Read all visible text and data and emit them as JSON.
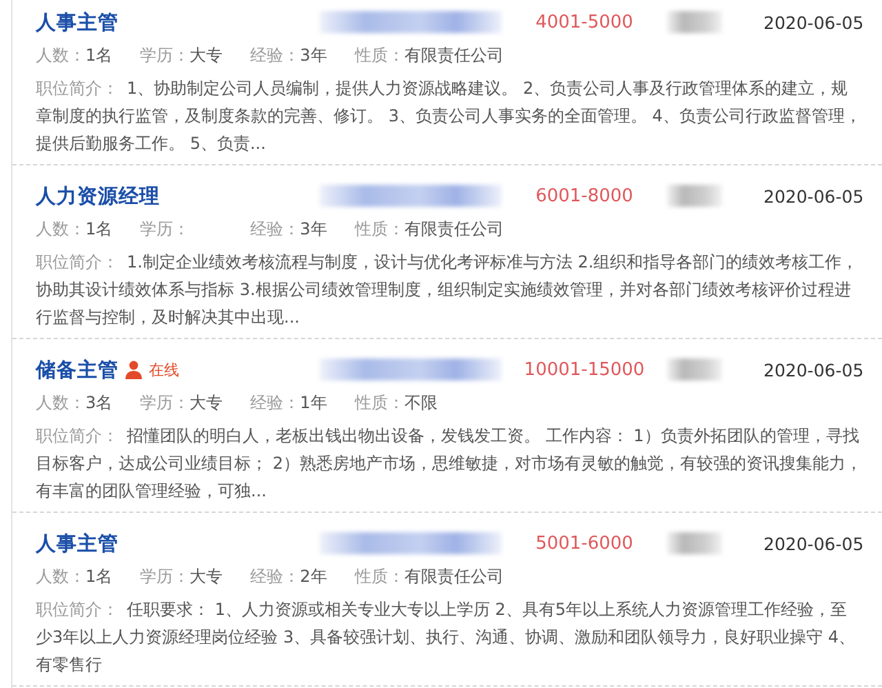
{
  "jobs": [
    {
      "title": "人事主管",
      "online": false,
      "salary": "4001-5000",
      "date": "2020-06-05",
      "meta": [
        {
          "label": "人数：",
          "value": "1名"
        },
        {
          "label": "学历：",
          "value": "大专"
        },
        {
          "label": "经验：",
          "value": "3年"
        },
        {
          "label": "性质：",
          "value": "有限责任公司"
        }
      ],
      "description_label": "职位简介：",
      "description": "1、协助制定公司人员编制，提供人力资源战略建议。 2、负责公司人事及行政管理体系的建立，规章制度的执行监管，及制度条款的完善、修订。 3、负责公司人事实务的全面管理。 4、负责公司行政监督管理，提供后勤服务工作。 5、负责..."
    },
    {
      "title": "人力资源经理",
      "online": false,
      "salary": "6001-8000",
      "date": "2020-06-05",
      "meta": [
        {
          "label": "人数：",
          "value": "1名"
        },
        {
          "label": "学历："
        },
        {
          "label": "经验：",
          "value": "3年"
        },
        {
          "label": "性质：",
          "value": "有限责任公司"
        }
      ],
      "description_label": "职位简介：",
      "description": "1.制定企业绩效考核流程与制度，设计与优化考评标准与方法 2.组织和指导各部门的绩效考核工作，协助其设计绩效体系与指标 3.根据公司绩效管理制度，组织制定实施绩效管理，并对各部门绩效考核评价过程进行监督与控制，及时解决其中出现..."
    },
    {
      "title": "储备主管",
      "online": true,
      "online_label": "在线",
      "salary": "10001-15000",
      "date": "2020-06-05",
      "meta": [
        {
          "label": "人数：",
          "value": "3名"
        },
        {
          "label": "学历：",
          "value": "大专"
        },
        {
          "label": "经验：",
          "value": "1年"
        },
        {
          "label": "性质：",
          "value": "不限"
        }
      ],
      "description_label": "职位简介：",
      "description": "招懂团队的明白人，老板出钱出物出设备，发钱发工资。 工作内容： 1）负责外拓团队的管理，寻找目标客户，达成公司业绩目标； 2）熟悉房地产市场，思维敏捷，对市场有灵敏的触觉，有较强的资讯搜集能力，有丰富的团队管理经验，可独..."
    },
    {
      "title": "人事主管",
      "online": false,
      "salary": "5001-6000",
      "date": "2020-06-05",
      "meta": [
        {
          "label": "人数：",
          "value": "1名"
        },
        {
          "label": "学历：",
          "value": "大专"
        },
        {
          "label": "经验：",
          "value": "2年"
        },
        {
          "label": "性质：",
          "value": "有限责任公司"
        }
      ],
      "description_label": "职位简介：",
      "description": "任职要求： 1、人力资源或相关专业大专以上学历 2、具有5年以上系统人力资源管理工作经验，至少3年以上人力资源经理岗位经验 3、具备较强计划、执行、沟通、协调、激励和团队领导力，良好职业操守 4、有零售行"
    }
  ]
}
